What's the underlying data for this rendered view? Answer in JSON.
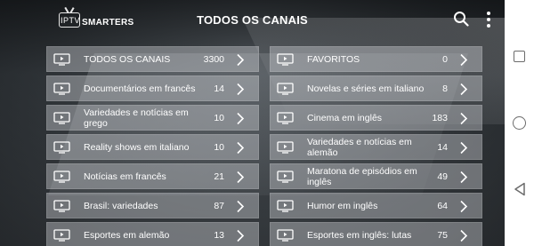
{
  "app": {
    "logo_iptv": "IPTV",
    "logo_smarters": "SMARTERS",
    "title": "TODOS OS CANAIS"
  },
  "icons": {
    "search": "search-icon",
    "more": "more-vertical-icon",
    "tile": "tv-icon",
    "chevron": "chevron-right-icon"
  },
  "categories": [
    {
      "label": "TODOS OS CANAIS",
      "count": "3300"
    },
    {
      "label": "FAVORITOS",
      "count": "0"
    },
    {
      "label": "Documentários em francês",
      "count": "14"
    },
    {
      "label": "Novelas e séries em italiano",
      "count": "8"
    },
    {
      "label": "Variedades e notícias em grego",
      "count": "10"
    },
    {
      "label": "Cinema em inglês",
      "count": "183"
    },
    {
      "label": "Reality shows em italiano",
      "count": "10"
    },
    {
      "label": "Variedades e notícias em alemão",
      "count": "14"
    },
    {
      "label": "Notícias em francês",
      "count": "21"
    },
    {
      "label": "Maratona de episódios em inglês",
      "count": "49"
    },
    {
      "label": "Brasil: variedades",
      "count": "87"
    },
    {
      "label": "Humor em inglês",
      "count": "64"
    },
    {
      "label": "Esportes em alemão",
      "count": "13"
    },
    {
      "label": "Esportes em inglês: lutas",
      "count": "75"
    }
  ],
  "system_nav": {
    "recents": "square-icon",
    "home": "circle-icon",
    "back": "triangle-back-icon"
  }
}
